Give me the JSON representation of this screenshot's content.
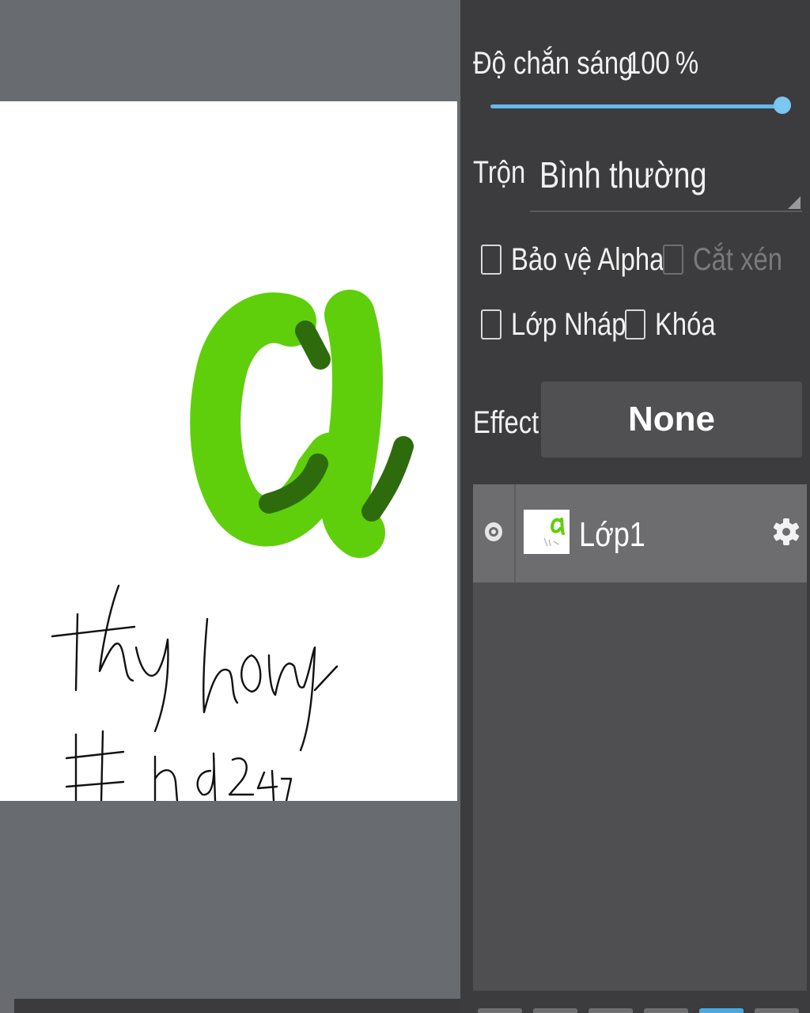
{
  "layer_properties": {
    "opacity_label": "Độ chắn sáng",
    "opacity_value": "100",
    "opacity_unit": "%",
    "opacity_fraction": 1.0,
    "blend_label": "Trộn",
    "blend_value": "Bình thường",
    "checkboxes": {
      "alpha_protect": {
        "label": "Bảo vệ Alpha",
        "checked": false
      },
      "clipping": {
        "label": "Cắt xén",
        "checked": false,
        "disabled": true
      },
      "draft_layer": {
        "label": "Lớp Nháp",
        "checked": false
      },
      "lock": {
        "label": "Khóa",
        "checked": false
      }
    },
    "effect_label": "Effect",
    "effect_value": "None"
  },
  "layers": [
    {
      "name": "Lớp1",
      "visible": true
    }
  ],
  "colors": {
    "accent": "#64b9e8",
    "letter_light_green": "#5fcf0c",
    "letter_dark_green": "#2e6b0d"
  },
  "icons": {
    "eye": "eye-icon",
    "settings": "gear-icon"
  }
}
